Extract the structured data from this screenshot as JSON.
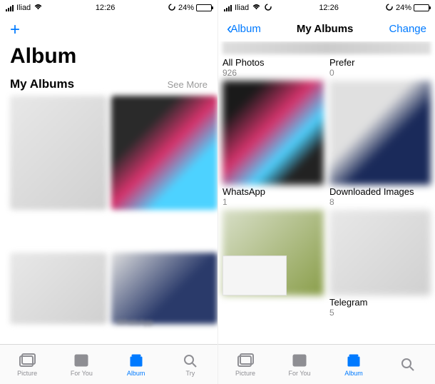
{
  "status": {
    "carrier": "Iliad",
    "time": "12:26",
    "battery_pct": "24%"
  },
  "s1": {
    "title": "Album",
    "section_title": "My Albums",
    "see_more": "See More",
    "blur_text": "WhatsApp"
  },
  "s2": {
    "back": "Album",
    "nav_title": "My Albums",
    "nav_action": "Change",
    "albums": [
      {
        "name": "All Photos",
        "count": "926"
      },
      {
        "name": "Prefer",
        "count": "0"
      },
      {
        "name": "WhatsApp",
        "count": "1"
      },
      {
        "name": "Downloaded Images",
        "count": "8"
      },
      {
        "name": "",
        "count": ""
      },
      {
        "name": "Telegram",
        "count": "5"
      }
    ]
  },
  "tabs": {
    "picture": "Picture",
    "foryou": "For You",
    "album": "Album",
    "search": "Try",
    "search2": ""
  }
}
